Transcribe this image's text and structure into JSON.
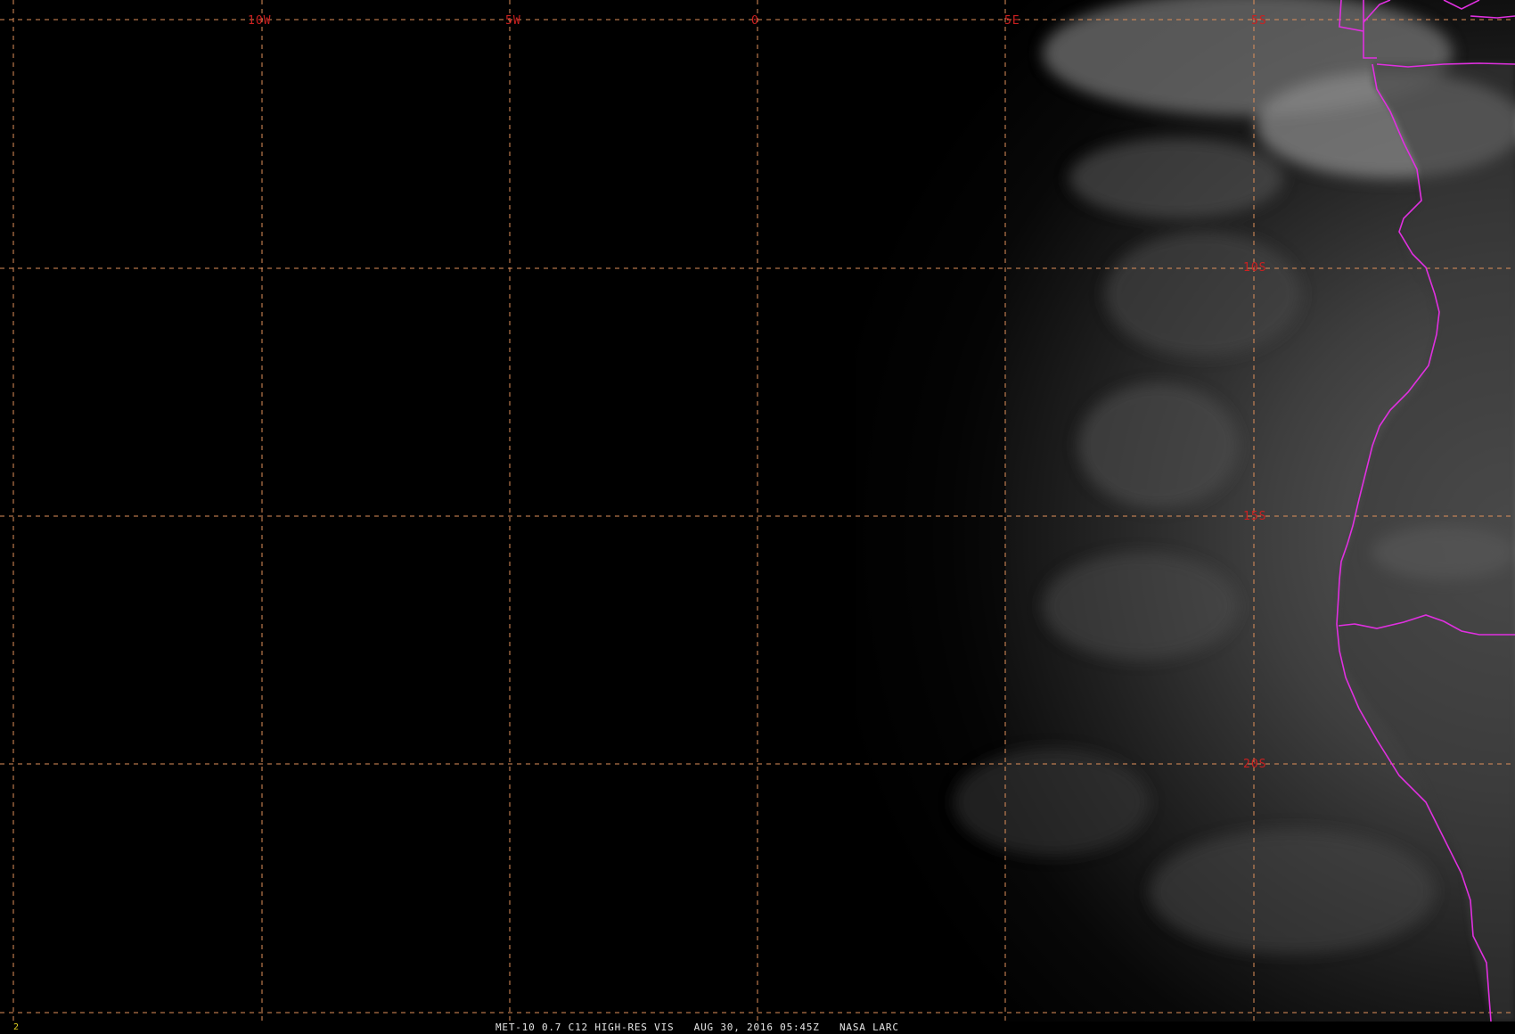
{
  "image": {
    "satellite": "MET-10",
    "channel_label": "MET-10 0.7 C12 HIGH-RES VIS",
    "datetime": "AUG 30, 2016 05:45Z",
    "credit": "NASA LARC",
    "frame_number": "2",
    "status_line": "MET-10 0.7 C12 HIGH-RES VIS   AUG 30, 2016 05:45Z   NASA LARC"
  },
  "map": {
    "longitude_labels": [
      "10W",
      "5W",
      "0",
      "5E",
      "5S"
    ],
    "latitude_labels": [
      "10S",
      "15S",
      "20S"
    ],
    "colors": {
      "background": "#000000",
      "gridline": "#e0905a",
      "grid_label": "#cc2020",
      "border": "#e030e0",
      "frame_number": "#e0d020",
      "status_text": "#e6e6e6"
    },
    "icons": {
      "gridline": "dashed-line",
      "border": "political-boundary-line"
    }
  }
}
